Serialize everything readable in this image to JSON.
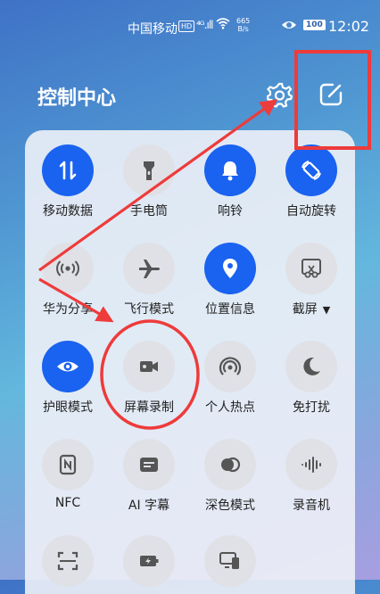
{
  "status_bar": {
    "carrier": "中国移动",
    "hd": "HD",
    "signal": "⁴ᴳ.ıll",
    "net_speed": "665\nB/s",
    "battery": "100",
    "time": "12:02"
  },
  "header": {
    "title": "控制中心"
  },
  "tiles": [
    {
      "label": "移动数据",
      "icon": "mobile-data-icon",
      "active": true
    },
    {
      "label": "手电筒",
      "icon": "flashlight-icon",
      "active": false
    },
    {
      "label": "响铃",
      "icon": "bell-icon",
      "active": true
    },
    {
      "label": "自动旋转",
      "icon": "auto-rotate-icon",
      "active": true
    },
    {
      "label": "华为分享",
      "icon": "huawei-share-icon",
      "active": false
    },
    {
      "label": "飞行模式",
      "icon": "airplane-icon",
      "active": false
    },
    {
      "label": "位置信息",
      "icon": "location-icon",
      "active": true
    },
    {
      "label": "截屏",
      "icon": "screenshot-icon",
      "active": false
    },
    {
      "label": "护眼模式",
      "icon": "eye-icon",
      "active": true
    },
    {
      "label": "屏幕录制",
      "icon": "screen-record-icon",
      "active": false
    },
    {
      "label": "个人热点",
      "icon": "hotspot-icon",
      "active": false
    },
    {
      "label": "免打扰",
      "icon": "moon-icon",
      "active": false
    },
    {
      "label": "NFC",
      "icon": "nfc-icon",
      "active": false
    },
    {
      "label": "AI 字幕",
      "icon": "ai-subtitle-icon",
      "active": false
    },
    {
      "label": "深色模式",
      "icon": "dark-mode-icon",
      "active": false
    },
    {
      "label": "录音机",
      "icon": "recorder-icon",
      "active": false
    },
    {
      "label": "",
      "icon": "scan-icon",
      "active": false
    },
    {
      "label": "",
      "icon": "battery-saver-icon",
      "active": false
    },
    {
      "label": "",
      "icon": "multi-screen-icon",
      "active": false
    }
  ],
  "colors": {
    "active": "#1a62f0",
    "inactive": "#dfe1e6",
    "annotation": "#ee3b3b"
  }
}
